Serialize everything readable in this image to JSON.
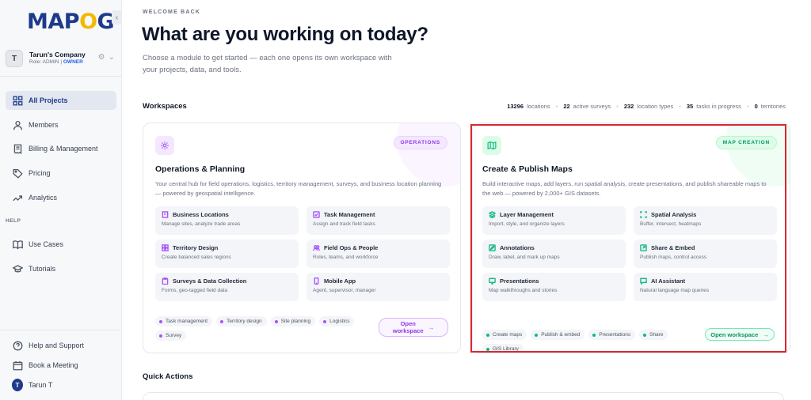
{
  "brand": {
    "logo_left": "MAP",
    "logo_pin": "O",
    "logo_right": "G"
  },
  "org": {
    "avatar": "T",
    "name": "Tarun's Company",
    "role_prefix": "Role: ADMIN | ",
    "role_badge": "OWNER"
  },
  "nav": {
    "items": [
      {
        "label": "All Projects"
      },
      {
        "label": "Members"
      },
      {
        "label": "Billing & Management"
      },
      {
        "label": "Pricing"
      },
      {
        "label": "Analytics"
      }
    ],
    "help_label": "HELP",
    "help_items": [
      {
        "label": "Use Cases"
      },
      {
        "label": "Tutorials"
      }
    ],
    "footer_items": [
      {
        "label": "Help and Support"
      },
      {
        "label": "Book a Meeting"
      }
    ],
    "user": {
      "avatar": "T",
      "name": "Tarun T"
    }
  },
  "header": {
    "eyebrow": "WELCOME BACK",
    "title": "What are you working on today?",
    "subtitle": "Choose a module to get started — each one opens its own workspace with your projects, data, and tools."
  },
  "workspaces": {
    "title": "Workspaces",
    "stats": [
      {
        "value": "13296",
        "label": "locations"
      },
      {
        "value": "22",
        "label": "active surveys"
      },
      {
        "value": "232",
        "label": "location types"
      },
      {
        "value": "35",
        "label": "tasks in progress"
      },
      {
        "value": "0",
        "label": "territories"
      }
    ],
    "cards": [
      {
        "badge": "OPERATIONS",
        "title": "Operations & Planning",
        "description": "Your central hub for field operations, logistics, territory management, surveys, and business location planning — powered by geospatial intelligence.",
        "tiles": [
          {
            "title": "Business Locations",
            "subtitle": "Manage sites, analyze trade areas"
          },
          {
            "title": "Task Management",
            "subtitle": "Assign and track field tasks"
          },
          {
            "title": "Territory Design",
            "subtitle": "Create balanced sales regions"
          },
          {
            "title": "Field Ops & People",
            "subtitle": "Roles, teams, and workforce"
          },
          {
            "title": "Surveys & Data Collection",
            "subtitle": "Forms, geo-tagged field data"
          },
          {
            "title": "Mobile App",
            "subtitle": "Agent, supervisor, manager"
          }
        ],
        "tags": [
          "Task management",
          "Territory design",
          "Site planning",
          "Logistics",
          "Survey"
        ],
        "button_line1": "Open",
        "button_line2": "workspace",
        "accent": "#a855f7"
      },
      {
        "badge": "MAP CREATION",
        "title": "Create & Publish Maps",
        "description": "Build interactive maps, add layers, run spatial analysis, create presentations, and publish shareable maps to the web — powered by 2,000+ GIS datasets.",
        "tiles": [
          {
            "title": "Layer Management",
            "subtitle": "Import, style, and organize layers"
          },
          {
            "title": "Spatial Analysis",
            "subtitle": "Buffer, intersect, heatmaps"
          },
          {
            "title": "Annotations",
            "subtitle": "Draw, label, and mark up maps"
          },
          {
            "title": "Share & Embed",
            "subtitle": "Publish maps, control access"
          },
          {
            "title": "Presentations",
            "subtitle": "Map walkthroughs and stories"
          },
          {
            "title": "AI Assistant",
            "subtitle": "Natural language map queries"
          }
        ],
        "tags": [
          "Create maps",
          "Publish & embed",
          "Presentations",
          "Share",
          "GIS Library"
        ],
        "button_label": "Open workspace",
        "accent": "#10b981"
      }
    ]
  },
  "quick_actions": {
    "title": "Quick Actions"
  }
}
